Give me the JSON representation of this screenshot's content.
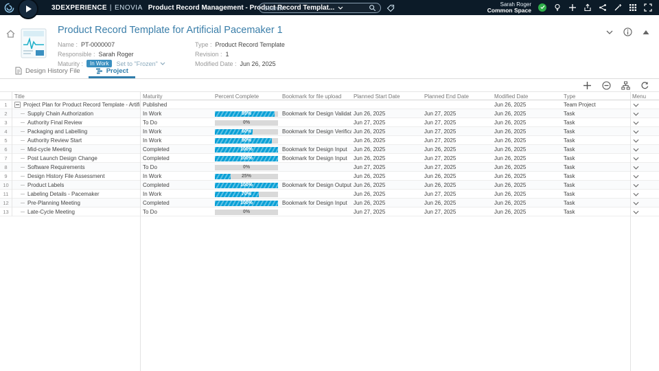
{
  "topbar": {
    "brand": "3DEXPERIENCE",
    "brand_sep": "|",
    "brand_product": "ENOVIA",
    "app_title": "Product Record Management - Product Record Templat...",
    "search_placeholder": "Search",
    "user_name": "Sarah Roger",
    "user_space": "Common Space"
  },
  "header": {
    "title": "Product Record Template for Artificial Pacemaker 1",
    "name_label": "Name",
    "name_value": "PT-0000007",
    "responsible_label": "Responsible",
    "responsible_value": "Sarah Roger",
    "maturity_label": "Maturity",
    "maturity_value": "In Work",
    "maturity_action": "Set to \"Frozen\"",
    "type_label": "Type",
    "type_value": "Product Record Template",
    "revision_label": "Revision",
    "revision_value": "1",
    "modified_label": "Modified Date",
    "modified_value": "Jun 26, 2025"
  },
  "tabs": [
    {
      "label": "Design History File"
    },
    {
      "label": "Project"
    }
  ],
  "table": {
    "columns": [
      "Title",
      "Maturity",
      "Percent Complete",
      "Bookmark for file upload",
      "Planned Start Date",
      "Planned End Date",
      "Modified Date",
      "Type",
      "Menu"
    ],
    "rows": [
      {
        "root": true,
        "title": "Project Plan for Product Record Template - Artificial Pacemaker",
        "maturity": "Published",
        "percent": null,
        "bookmark": "",
        "start": "",
        "end": "",
        "modified": "Jun 26, 2025",
        "type": "Team Project"
      },
      {
        "title": "Supply Chain Authorization",
        "maturity": "In Work",
        "percent": 95,
        "bookmark": "Bookmark for Design Validation",
        "start": "Jun 26, 2025",
        "end": "Jun 27, 2025",
        "modified": "Jun 26, 2025",
        "type": "Task"
      },
      {
        "title": "Authority Final Review",
        "maturity": "To Do",
        "percent": 0,
        "bookmark": "",
        "start": "Jun 27, 2025",
        "end": "Jun 27, 2025",
        "modified": "Jun 26, 2025",
        "type": "Task"
      },
      {
        "title": "Packaging and Labelling",
        "maturity": "In Work",
        "percent": 60,
        "bookmark": "Bookmark for Design Verification",
        "start": "Jun 26, 2025",
        "end": "Jun 27, 2025",
        "modified": "Jun 26, 2025",
        "type": "Task"
      },
      {
        "title": "Authority Review Start",
        "maturity": "In Work",
        "percent": 90,
        "bookmark": "",
        "start": "Jun 26, 2025",
        "end": "Jun 27, 2025",
        "modified": "Jun 26, 2025",
        "type": "Task"
      },
      {
        "title": "Mid-cycle Meeting",
        "maturity": "Completed",
        "percent": 100,
        "bookmark": "Bookmark for Design Input",
        "start": "Jun 26, 2025",
        "end": "Jun 26, 2025",
        "modified": "Jun 26, 2025",
        "type": "Task"
      },
      {
        "title": "Post Launch Design Change",
        "maturity": "Completed",
        "percent": 100,
        "bookmark": "Bookmark for Design Input",
        "start": "Jun 26, 2025",
        "end": "Jun 27, 2025",
        "modified": "Jun 26, 2025",
        "type": "Task"
      },
      {
        "title": "Software Requirements",
        "maturity": "To Do",
        "percent": 0,
        "bookmark": "",
        "start": "Jun 27, 2025",
        "end": "Jun 27, 2025",
        "modified": "Jun 26, 2025",
        "type": "Task"
      },
      {
        "title": "Design History File Assessment",
        "maturity": "In Work",
        "percent": 25,
        "bookmark": "",
        "start": "Jun 26, 2025",
        "end": "Jun 26, 2025",
        "modified": "Jun 26, 2025",
        "type": "Task"
      },
      {
        "title": "Product Labels",
        "maturity": "Completed",
        "percent": 100,
        "bookmark": "Bookmark for Design Output",
        "start": "Jun 26, 2025",
        "end": "Jun 26, 2025",
        "modified": "Jun 26, 2025",
        "type": "Task"
      },
      {
        "title": "Labeling Details - Pacemaker",
        "maturity": "In Work",
        "percent": 70,
        "bookmark": "",
        "start": "Jun 26, 2025",
        "end": "Jun 27, 2025",
        "modified": "Jun 26, 2025",
        "type": "Task"
      },
      {
        "title": "Pre-Planning Meeting",
        "maturity": "Completed",
        "percent": 100,
        "bookmark": "Bookmark for Design Input",
        "start": "Jun 26, 2025",
        "end": "Jun 26, 2025",
        "modified": "Jun 26, 2025",
        "type": "Task"
      },
      {
        "title": "Late-Cycle Meeting",
        "maturity": "To Do",
        "percent": 0,
        "bookmark": "",
        "start": "Jun 27, 2025",
        "end": "Jun 27, 2025",
        "modified": "Jun 26, 2025",
        "type": "Task"
      }
    ]
  },
  "colors": {
    "accent": "#2f7dab",
    "progress_fill": "#09a0d6",
    "badge_blue": "#3a8fc0",
    "badge_green": "#2fae49",
    "topbar_bg": "#0c1b28"
  }
}
